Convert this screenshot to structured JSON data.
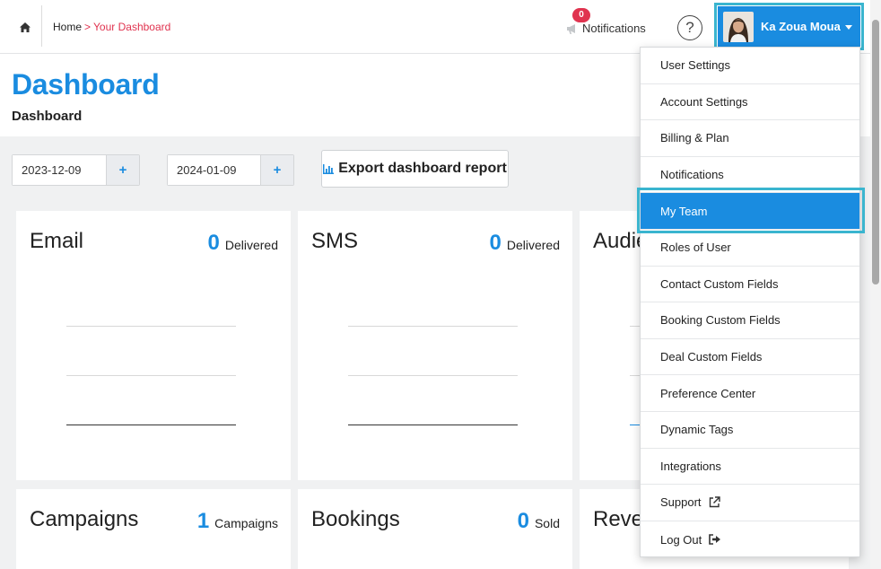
{
  "topbar": {
    "breadcrumb_home": "Home",
    "breadcrumb_sep": ">",
    "breadcrumb_current": "Your Dashboard",
    "notifications_label": "Notifications",
    "notifications_count": "0",
    "help_symbol": "?",
    "user_name": "Ka Zoua Moua"
  },
  "header": {
    "title": "Dashboard",
    "subtitle": "Dashboard"
  },
  "controls": {
    "start_date": "2023-12-09",
    "end_date": "2024-01-09",
    "plus_symbol": "+",
    "export_label": "Export dashboard report"
  },
  "cards": [
    {
      "title": "Email",
      "count": "0",
      "unit": "Delivered"
    },
    {
      "title": "SMS",
      "count": "0",
      "unit": "Delivered"
    },
    {
      "title": "Audie",
      "count": "",
      "unit": ""
    },
    {
      "title": "Campaigns",
      "count": "1",
      "unit": "Campaigns"
    },
    {
      "title": "Bookings",
      "count": "0",
      "unit": "Sold"
    },
    {
      "title": "Reve",
      "count": "",
      "unit": ""
    }
  ],
  "user_menu": {
    "items": [
      {
        "label": "User Settings"
      },
      {
        "label": "Account Settings"
      },
      {
        "label": "Billing & Plan"
      },
      {
        "label": "Notifications"
      },
      {
        "label": "My Team",
        "active": true
      },
      {
        "label": "Roles of User"
      },
      {
        "label": "Contact Custom Fields"
      },
      {
        "label": "Booking Custom Fields"
      },
      {
        "label": "Deal Custom Fields"
      },
      {
        "label": "Preference Center"
      },
      {
        "label": "Dynamic Tags"
      },
      {
        "label": "Integrations"
      },
      {
        "label": "Support",
        "icon": "external-link-icon"
      },
      {
        "label": "Log Out",
        "icon": "logout-icon"
      }
    ]
  },
  "icons": {
    "home": "home-icon",
    "notifications": "megaphone-icon",
    "help": "help-icon",
    "user_caret": "caret-down-icon",
    "export": "bar-chart-icon"
  },
  "colors": {
    "accent": "#1a8ce0",
    "highlight_outline": "#3ab5cf",
    "badge": "#e0334f",
    "breadcrumb_current": "#e0334f"
  }
}
